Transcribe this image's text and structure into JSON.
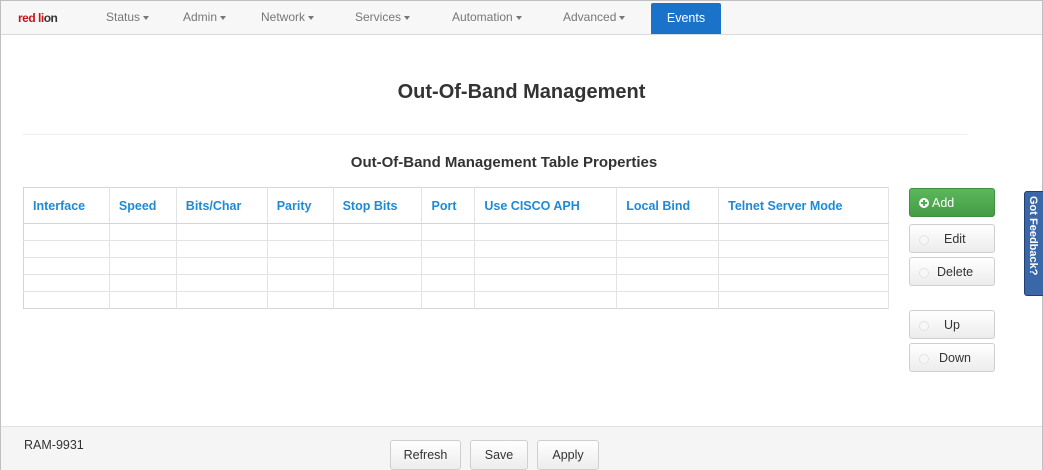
{
  "navbar": {
    "logo_red": "red l",
    "logo_glyph": "i",
    "logo_rest": "on",
    "menus": [
      {
        "label": "Status"
      },
      {
        "label": "Admin"
      },
      {
        "label": "Network"
      },
      {
        "label": "Services"
      },
      {
        "label": "Automation"
      },
      {
        "label": "Advanced"
      }
    ],
    "active": {
      "label": "Events"
    },
    "active_color": "#1a73c9"
  },
  "page": {
    "title": "Out-Of-Band Management",
    "table_title": "Out-Of-Band Management Table Properties"
  },
  "table": {
    "columns": [
      "Interface",
      "Speed",
      "Bits/Char",
      "Parity",
      "Stop Bits",
      "Port",
      "Use CISCO APH",
      "Local Bind",
      "Telnet Server Mode"
    ],
    "header_color": "#1e8ad6",
    "rows": 5
  },
  "actions": {
    "add": "Add",
    "edit": "Edit",
    "delete": "Delete",
    "up": "Up",
    "down": "Down",
    "add_color": "#5cb85c"
  },
  "feedback": {
    "label": "Got Feedback?",
    "color": "#3a67a8"
  },
  "footer": {
    "device": "RAM-9931",
    "refresh": "Refresh",
    "save": "Save",
    "apply": "Apply"
  }
}
